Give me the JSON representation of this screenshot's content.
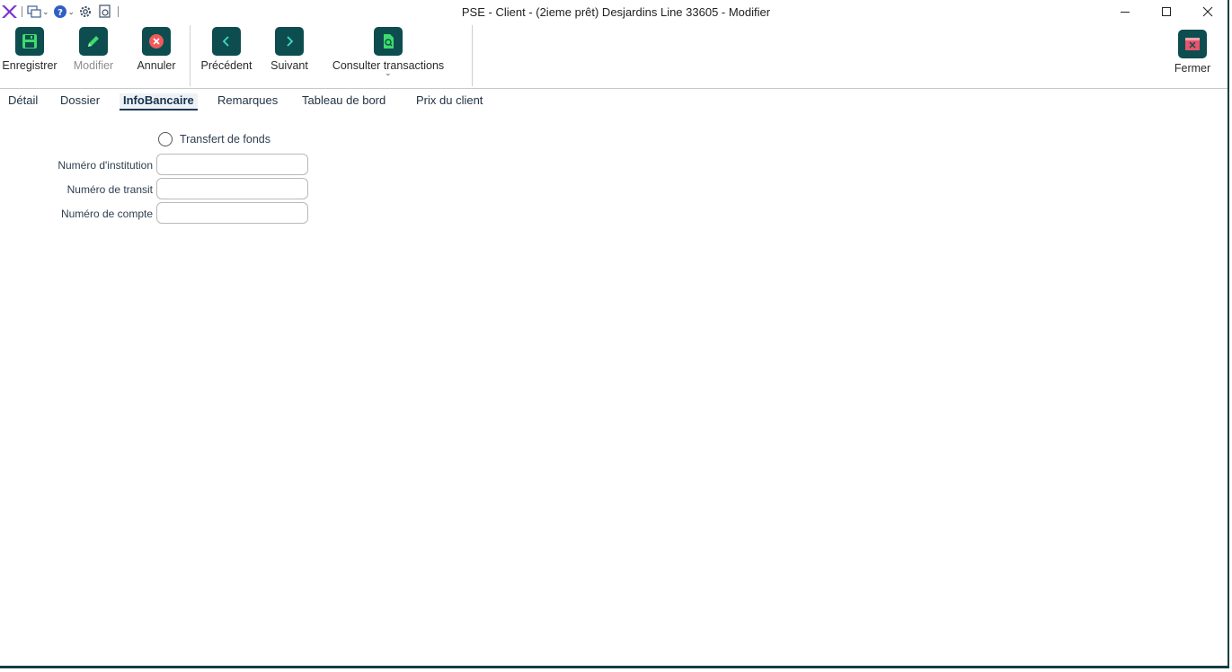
{
  "window": {
    "title": "PSE - Client - (2ieme prêt) Desjardins Line 33605 - Modifier",
    "accent_color": "#0d4d4f",
    "logo_color": "#7b2fd0"
  },
  "quick_access": {
    "icons": [
      "app-logo-icon",
      "windows-icon",
      "help-icon",
      "settings-icon",
      "document-icon"
    ]
  },
  "ribbon": {
    "save_label": "Enregistrer",
    "modify_label": "Modifier",
    "cancel_label": "Annuler",
    "previous_label": "Précédent",
    "next_label": "Suivant",
    "consult_label": "Consulter transactions",
    "close_label": "Fermer"
  },
  "tabs": [
    {
      "label": "Détail"
    },
    {
      "label": "Dossier"
    },
    {
      "label": "InfoBancaire",
      "active": true
    },
    {
      "label": "Remarques"
    },
    {
      "label": "Tableau de bord"
    },
    {
      "label": "Prix du client"
    }
  ],
  "form": {
    "fund_transfer_label": "Transfert de fonds",
    "fund_transfer_checked": false,
    "institution_label": "Numéro d'institution",
    "institution_value": "",
    "transit_label": "Numéro de transit",
    "transit_value": "",
    "account_label": "Numéro de compte",
    "account_value": ""
  }
}
